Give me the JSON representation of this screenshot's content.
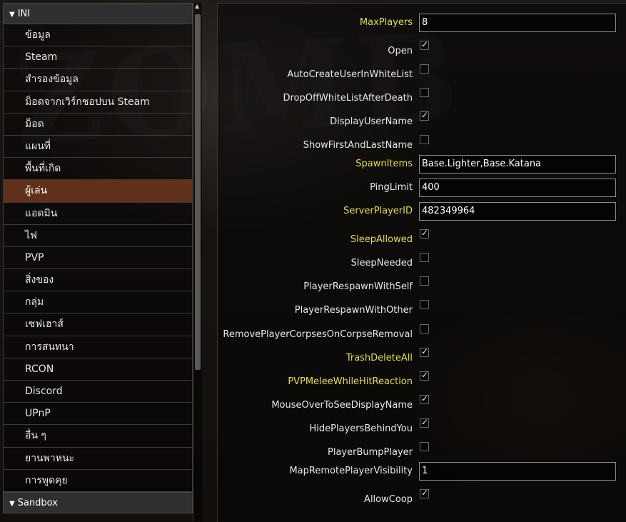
{
  "sidebar": {
    "ini_header": "INI",
    "items": [
      {
        "label": "ข้อมูล"
      },
      {
        "label": "Steam"
      },
      {
        "label": "สำรองข้อมูล"
      },
      {
        "label": "ม็อดจากเวิร์กชอปบน Steam"
      },
      {
        "label": "ม็อด"
      },
      {
        "label": "แผนที่"
      },
      {
        "label": "พื้นที่เกิด"
      },
      {
        "label": "ผู้เล่น"
      },
      {
        "label": "แอดมิน"
      },
      {
        "label": "ไฟ"
      },
      {
        "label": "PVP"
      },
      {
        "label": "สิ่งของ"
      },
      {
        "label": "กลุ่ม"
      },
      {
        "label": "เซฟเฮาส์"
      },
      {
        "label": "การสนทนา"
      },
      {
        "label": "RCON"
      },
      {
        "label": "Discord"
      },
      {
        "label": "UPnP"
      },
      {
        "label": "อื่น ๆ"
      },
      {
        "label": "ยานพาหนะ"
      },
      {
        "label": "การพูดคุย"
      }
    ],
    "active_item": "ผู้เล่น",
    "sandbox_header": "Sandbox"
  },
  "settings": {
    "max_players": {
      "label": "MaxPlayers",
      "value": "8"
    },
    "open": {
      "label": "Open",
      "checked": true
    },
    "auto_create_user_in_whitelist": {
      "label": "AutoCreateUserInWhiteList",
      "checked": false
    },
    "drop_off_whitelist_after_death": {
      "label": "DropOffWhiteListAfterDeath",
      "checked": false
    },
    "display_user_name": {
      "label": "DisplayUserName",
      "checked": true
    },
    "show_first_and_last_name": {
      "label": "ShowFirstAndLastName",
      "checked": false
    },
    "spawn_items": {
      "label": "SpawnItems",
      "value": "Base.Lighter,Base.Katana"
    },
    "ping_limit": {
      "label": "PingLimit",
      "value": "400"
    },
    "server_player_id": {
      "label": "ServerPlayerID",
      "value": "482349964"
    },
    "sleep_allowed": {
      "label": "SleepAllowed",
      "checked": true
    },
    "sleep_needed": {
      "label": "SleepNeeded",
      "checked": false
    },
    "player_respawn_with_self": {
      "label": "PlayerRespawnWithSelf",
      "checked": false
    },
    "player_respawn_with_other": {
      "label": "PlayerRespawnWithOther",
      "checked": false
    },
    "remove_player_corpses": {
      "label": "RemovePlayerCorpsesOnCorpseRemoval",
      "checked": false
    },
    "trash_delete_all": {
      "label": "TrashDeleteAll",
      "checked": true
    },
    "pvp_melee_while_hit_reaction": {
      "label": "PVPMeleeWhileHitReaction",
      "checked": true
    },
    "mouse_over_to_see_display_name": {
      "label": "MouseOverToSeeDisplayName",
      "checked": true
    },
    "hide_players_behind_you": {
      "label": "HidePlayersBehindYou",
      "checked": true
    },
    "player_bump_player": {
      "label": "PlayerBumpPlayer",
      "checked": false
    },
    "map_remote_player_visibility": {
      "label": "MapRemotePlayerVisibility",
      "value": "1"
    },
    "allow_coop": {
      "label": "AllowCoop",
      "checked": true
    }
  },
  "colors": {
    "highlight_label": "#e6df3e",
    "active_item": "#783a1e"
  },
  "icons": {
    "expand": "triangle-down-icon",
    "checkmark": "checkmark-icon"
  }
}
